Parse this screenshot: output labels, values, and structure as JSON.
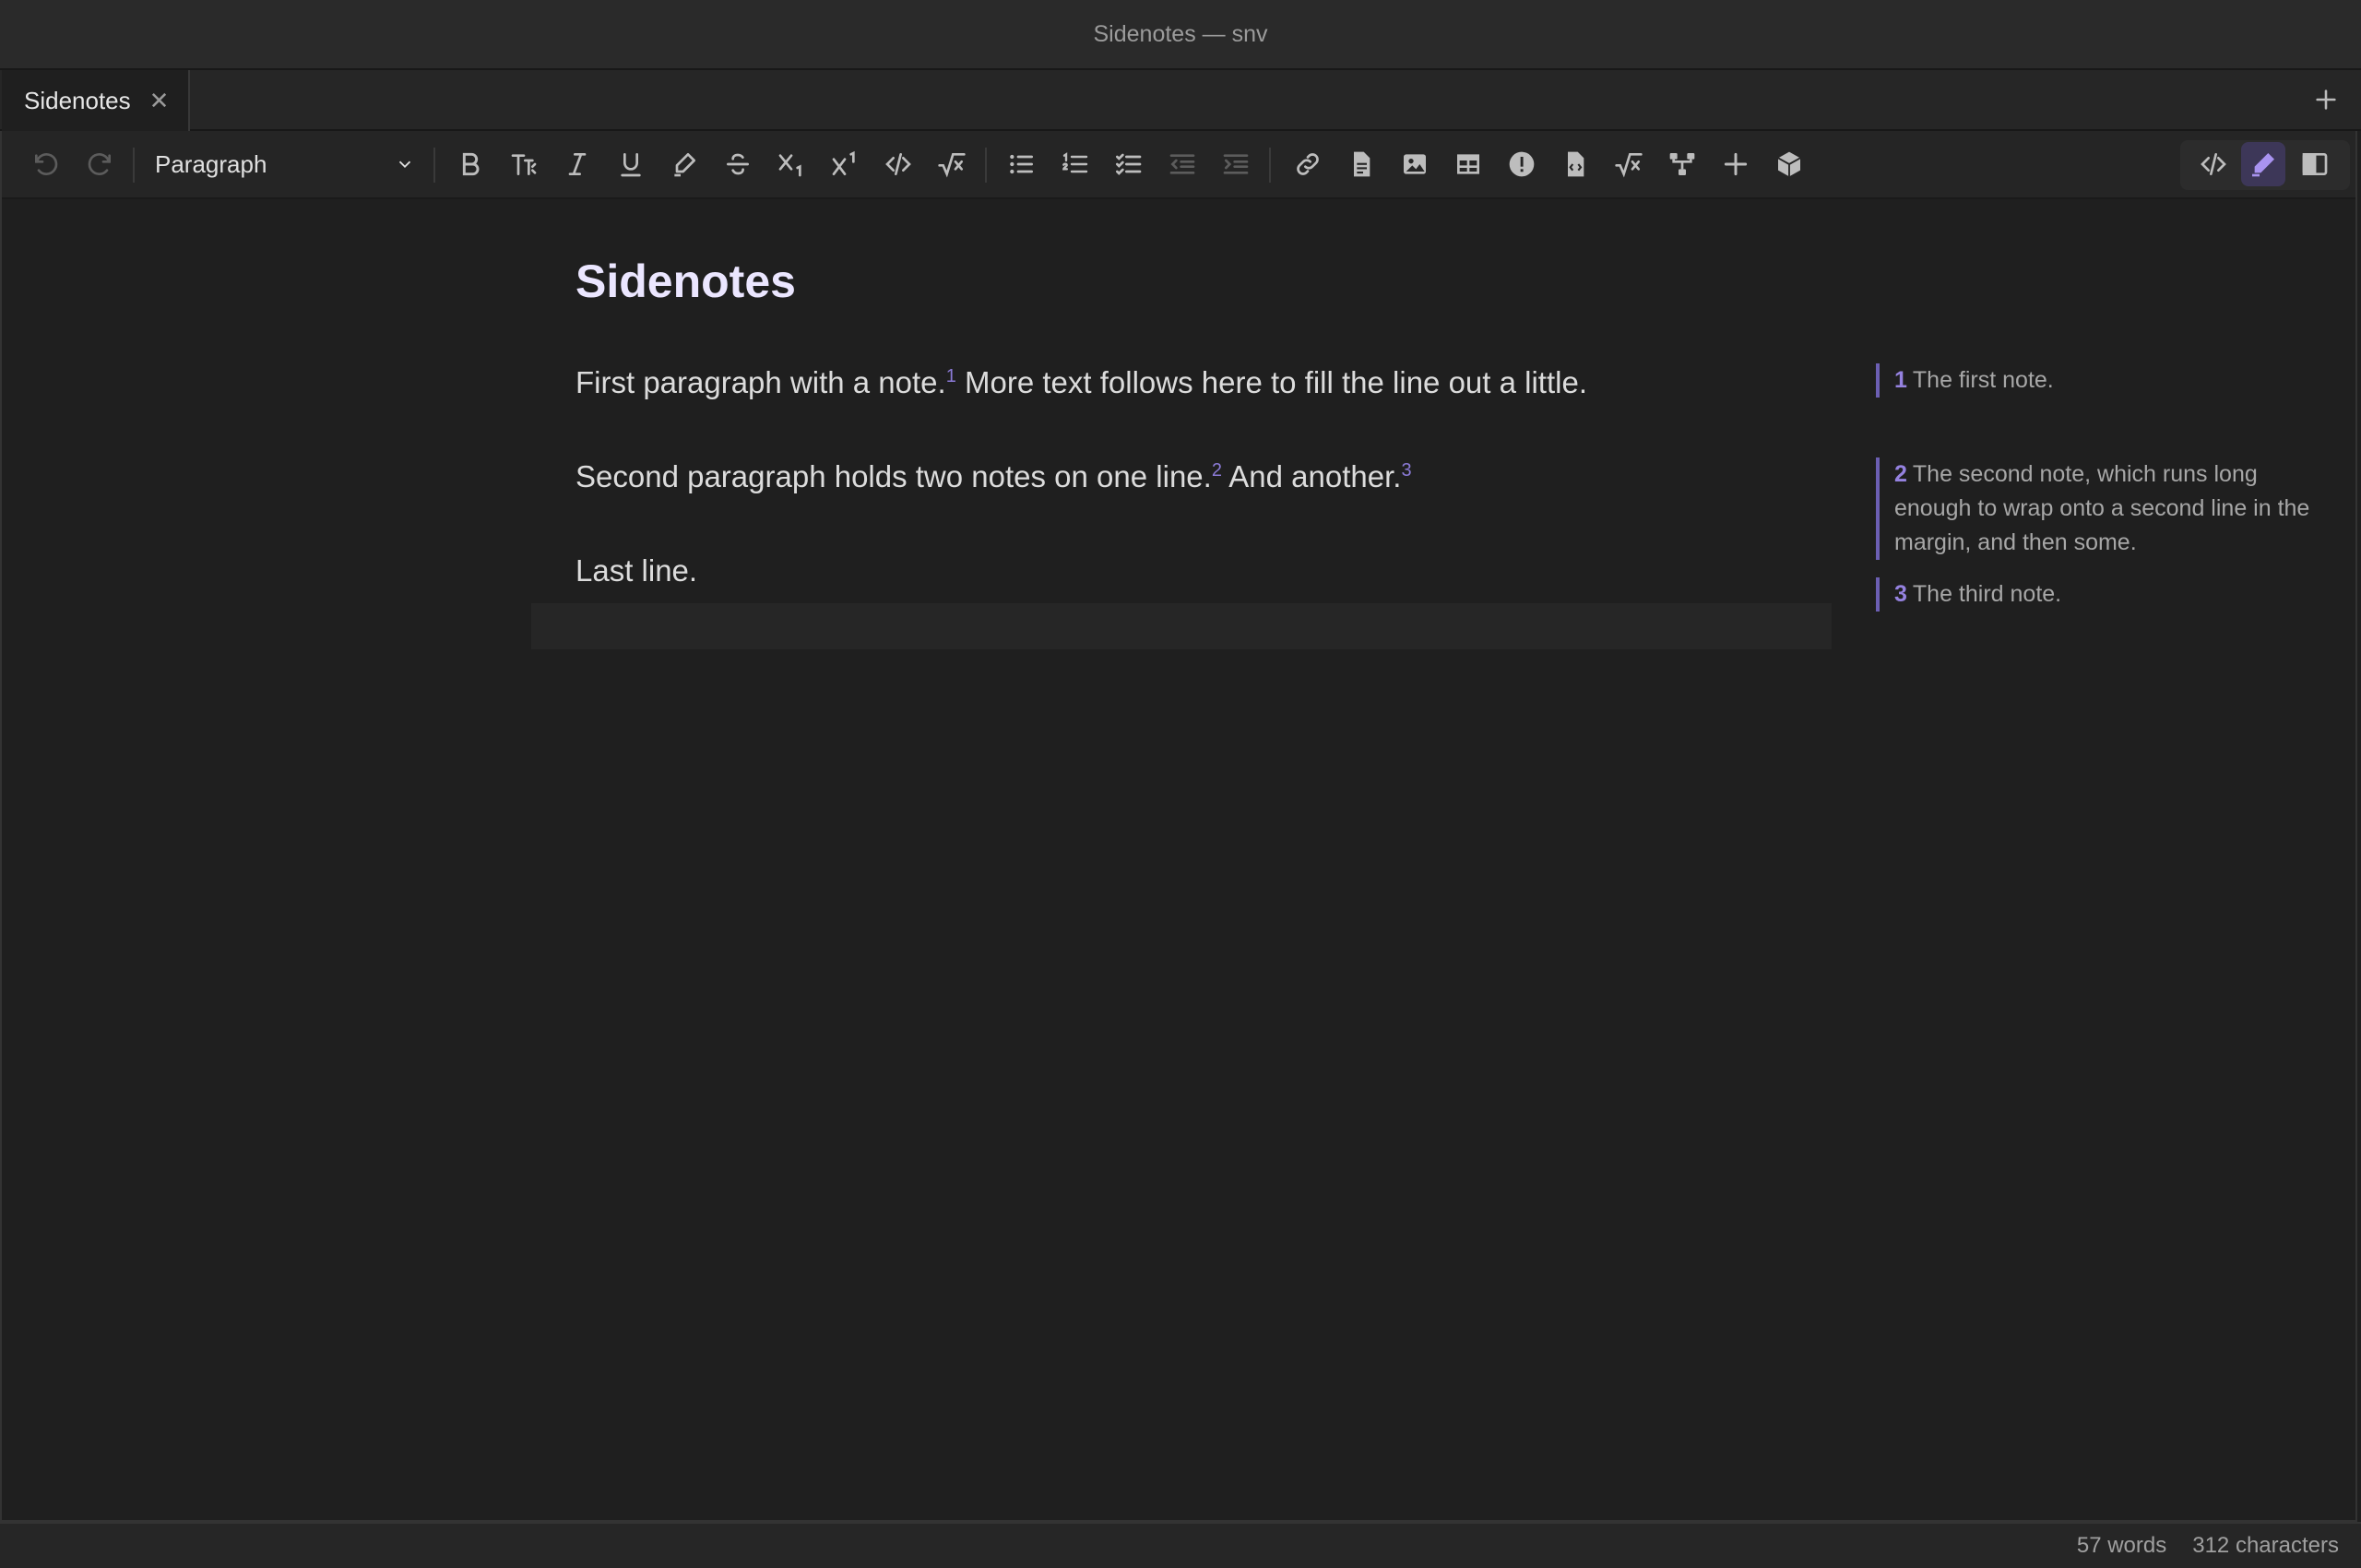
{
  "window": {
    "title": "Sidenotes — snv"
  },
  "tabs": [
    {
      "label": "Sidenotes",
      "close": "✕"
    }
  ],
  "tab_add": "+",
  "toolbar": {
    "block_type": "Paragraph",
    "icons": [
      "undo-icon",
      "redo-icon",
      "bold-icon",
      "heading-size-icon",
      "italic-icon",
      "underline-icon",
      "highlight-icon",
      "strikethrough-icon",
      "subscript-icon",
      "superscript-icon",
      "inline-code-icon",
      "inline-math-icon",
      "bullet-list-icon",
      "ordered-list-icon",
      "task-list-icon",
      "outdent-icon",
      "indent-icon",
      "link-icon",
      "document-icon",
      "image-icon",
      "table-icon",
      "callout-icon",
      "code-file-icon",
      "math-block-icon",
      "diagram-icon",
      "add-icon",
      "package-icon",
      "source-mode-icon",
      "edit-mode-icon",
      "reader-mode-icon"
    ],
    "mode": "edit"
  },
  "document": {
    "title": "Sidenotes",
    "paragraphs": [
      {
        "text_a": "First paragraph with a note.",
        "ref_a": "1",
        "text_b": " More text follows here to fill the line out a little."
      },
      {
        "text_a": "Second paragraph holds two notes on one line.",
        "ref_a": "2",
        "text_b": " And another.",
        "ref_b": "3"
      },
      {
        "text_a": "Last line."
      }
    ]
  },
  "sidenotes": [
    {
      "num": "1",
      "text": "The first note."
    },
    {
      "num": "2",
      "text": "The second note, which runs long enough to wrap onto a second line in the margin, and then some."
    },
    {
      "num": "3",
      "text": "The third note."
    }
  ],
  "status": {
    "words": "57 words",
    "characters": "312 characters"
  },
  "colors": {
    "accent": "#8b7ad6",
    "background": "#1f1f1f",
    "title": "#ebe6ff"
  }
}
